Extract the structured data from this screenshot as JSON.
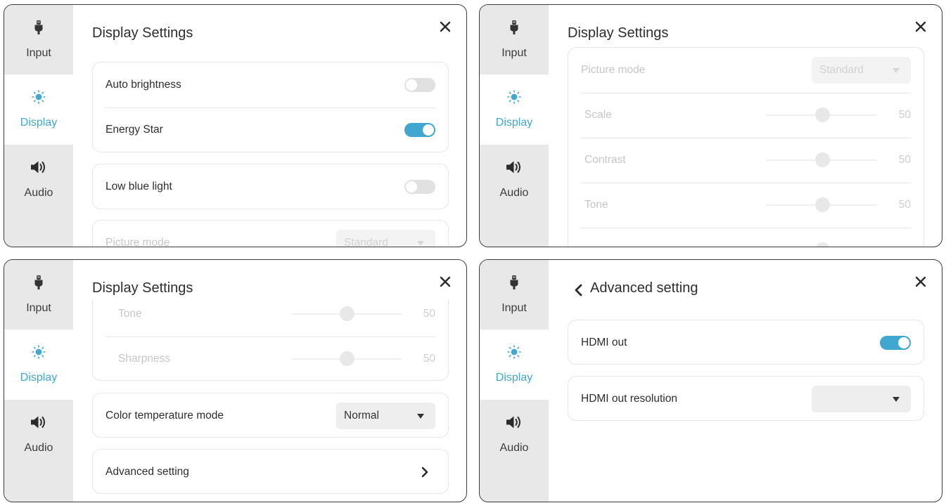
{
  "sidebar": {
    "items": [
      {
        "label": "Input",
        "icon": "plug-icon"
      },
      {
        "label": "Display",
        "icon": "sun-icon"
      },
      {
        "label": "Audio",
        "icon": "speaker-icon"
      }
    ]
  },
  "panel1": {
    "title": "Display Settings",
    "auto_brightness": {
      "label": "Auto brightness",
      "on": false
    },
    "energy_star": {
      "label": "Energy Star",
      "on": true
    },
    "low_blue_light": {
      "label": "Low blue light",
      "on": false
    },
    "picture_mode": {
      "label": "Picture mode",
      "value": "Standard"
    }
  },
  "panel2": {
    "title": "Display Settings",
    "picture_mode": {
      "label": "Picture mode",
      "value": "Standard"
    },
    "sliders": [
      {
        "label": "Scale",
        "value": "50",
        "level": 50
      },
      {
        "label": "Contrast",
        "value": "50",
        "level": 50
      },
      {
        "label": "Tone",
        "value": "50",
        "level": 50
      }
    ]
  },
  "panel3": {
    "title": "Display Settings",
    "sliders": [
      {
        "label": "Tone",
        "value": "50",
        "level": 50
      },
      {
        "label": "Sharpness",
        "value": "50",
        "level": 50
      }
    ],
    "color_temp": {
      "label": "Color temperature mode",
      "value": "Normal"
    },
    "advanced": {
      "label": "Advanced setting"
    }
  },
  "panel4": {
    "title": "Advanced setting",
    "hdmi_out": {
      "label": "HDMI out",
      "on": true
    },
    "hdmi_res": {
      "label": "HDMI out resolution",
      "value": ""
    }
  },
  "colors": {
    "accent": "#41a7cf",
    "sidebar_bg": "#e8e8e8",
    "toggle_off": "#e1e1e1"
  }
}
